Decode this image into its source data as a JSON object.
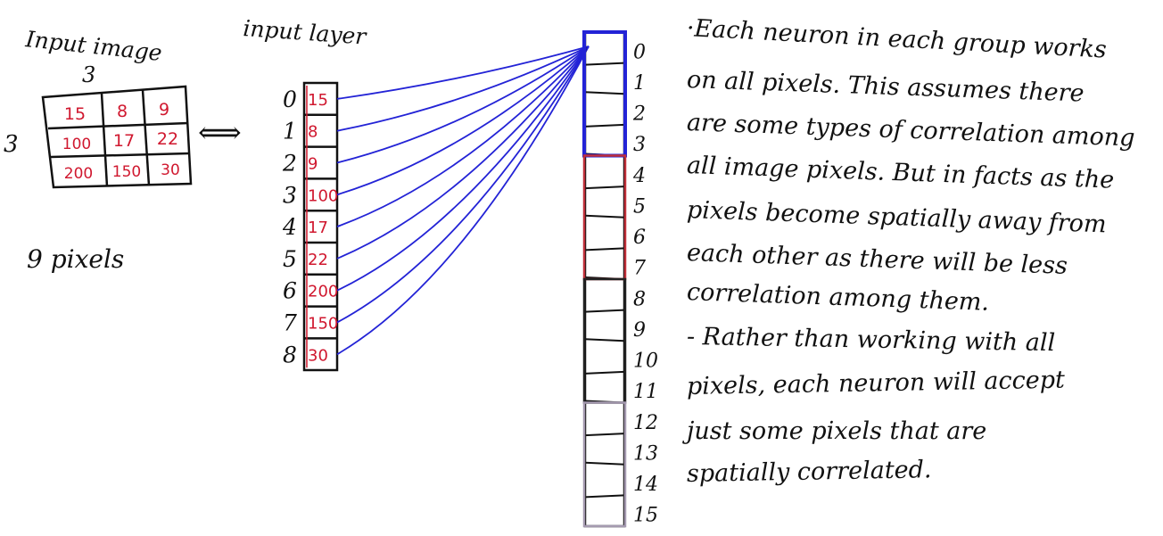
{
  "input_image": {
    "title": "Input image",
    "width_label": "3",
    "height_label": "3",
    "grid": [
      [
        "15",
        "8",
        "9"
      ],
      [
        "100",
        "17",
        "22"
      ],
      [
        "200",
        "150",
        "30"
      ]
    ],
    "arrow": "⟺",
    "caption": "9 pixels"
  },
  "input_layer": {
    "title": "input layer",
    "indices": [
      "0",
      "1",
      "2",
      "3",
      "4",
      "5",
      "6",
      "7",
      "8"
    ],
    "values": [
      "15",
      "8",
      "9",
      "100",
      "17",
      "22",
      "200",
      "150",
      "30"
    ],
    "value_color": "#d0182f"
  },
  "hidden_layer": {
    "indices": [
      "0",
      "1",
      "2",
      "3",
      "4",
      "5",
      "6",
      "7",
      "8",
      "9",
      "10",
      "11",
      "12",
      "13",
      "14",
      "15"
    ],
    "group_colors": [
      "#2323d6",
      "#c0303a",
      "#222222",
      "#a59ab0"
    ],
    "connection_color": "#2323d6"
  },
  "notes": [
    "·Each neuron in each group works",
    "on all pixels. This assumes there",
    "are some types of correlation among",
    "all image pixels. But in facts as the",
    "pixels become spatially away from",
    "each other as there will be less",
    "correlation among them.",
    "- Rather than working with all",
    "pixels, each neuron will accept",
    "just some pixels that are",
    "spatially correlated."
  ]
}
